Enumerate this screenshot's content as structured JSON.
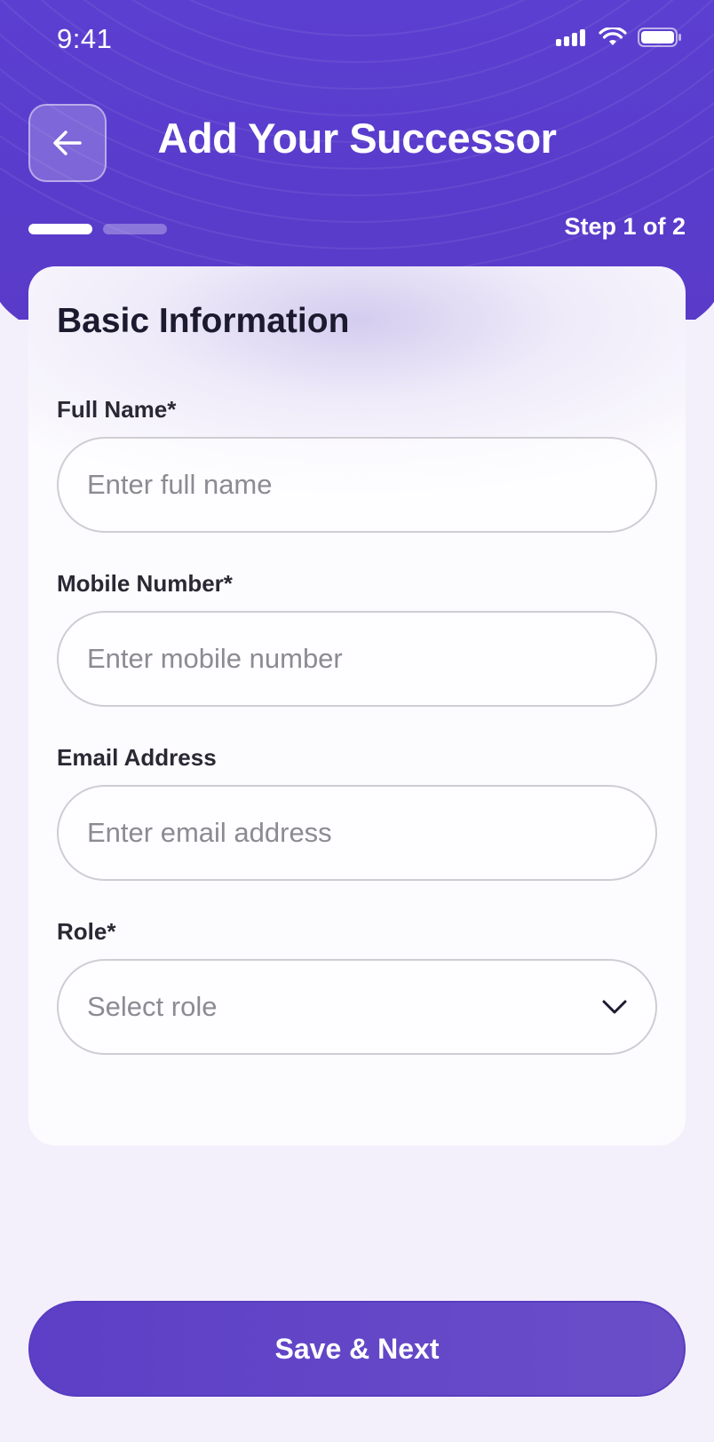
{
  "status_bar": {
    "time": "9:41"
  },
  "header": {
    "title": "Add Your Successor",
    "step_label": "Step 1 of 2",
    "progress": {
      "current_step": 1,
      "total_steps": 2
    }
  },
  "form": {
    "section_title": "Basic Information",
    "fields": [
      {
        "label": "Full Name*",
        "placeholder": "Enter full name",
        "value": ""
      },
      {
        "label": "Mobile Number*",
        "placeholder": "Enter mobile number",
        "value": ""
      },
      {
        "label": "Email Address",
        "placeholder": "Enter email address",
        "value": ""
      }
    ],
    "role": {
      "label": "Role*",
      "placeholder": "Select role"
    }
  },
  "actions": {
    "save_label": "Save & Next"
  },
  "colors": {
    "primary": "#5b3fd0",
    "background": "#f4f0fb",
    "card": "#fcfbfe"
  },
  "icons": {
    "back": "arrow-left-icon",
    "dropdown": "chevron-down-icon",
    "signal": "signal-icon",
    "wifi": "wifi-icon",
    "battery": "battery-icon"
  }
}
